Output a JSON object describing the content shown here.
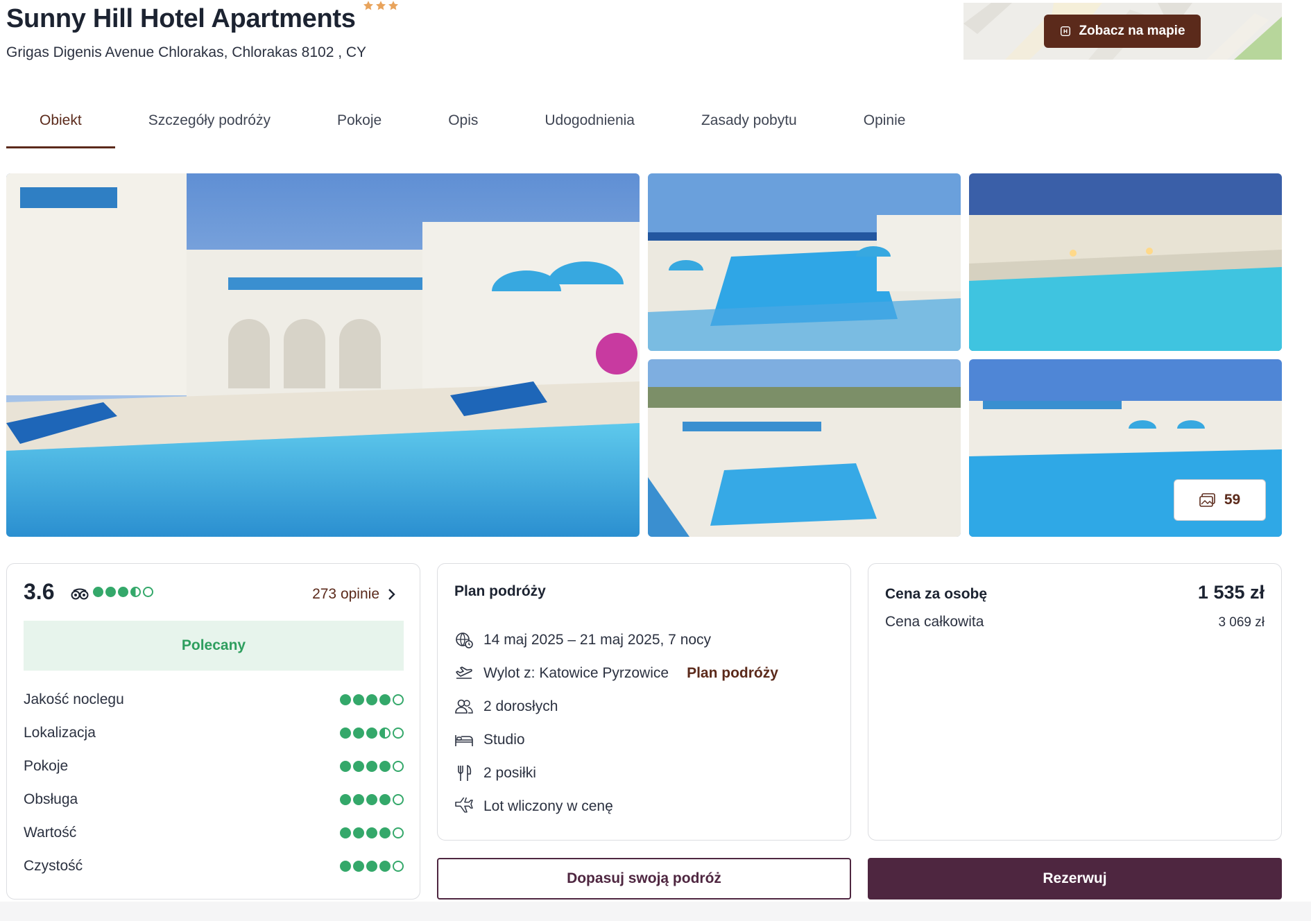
{
  "hotel": {
    "name": "Sunny Hill Hotel Apartments",
    "stars": 3,
    "address": "Grigas Digenis Avenue Chlorakas, Chlorakas 8102 , CY"
  },
  "map": {
    "button_label": "Zobacz na mapie"
  },
  "tabs": [
    {
      "label": "Obiekt",
      "active": true
    },
    {
      "label": "Szczegóły podróży",
      "active": false
    },
    {
      "label": "Pokoje",
      "active": false
    },
    {
      "label": "Opis",
      "active": false
    },
    {
      "label": "Udogodnienia",
      "active": false
    },
    {
      "label": "Zasady pobytu",
      "active": false
    },
    {
      "label": "Opinie",
      "active": false
    }
  ],
  "gallery": {
    "photo_count": "59"
  },
  "rating": {
    "score": "3.6",
    "bubbles": 3.5,
    "reviews_link": "273 opinie",
    "recommended_label": "Polecany",
    "criteria": [
      {
        "label": "Jakość noclegu",
        "bubbles": 4
      },
      {
        "label": "Lokalizacja",
        "bubbles": 3.5
      },
      {
        "label": "Pokoje",
        "bubbles": 4
      },
      {
        "label": "Obsługa",
        "bubbles": 4
      },
      {
        "label": "Wartość",
        "bubbles": 4
      },
      {
        "label": "Czystość",
        "bubbles": 4
      }
    ]
  },
  "plan": {
    "title": "Plan podróży",
    "dates": "14 maj 2025 – 21 maj 2025, 7 nocy",
    "departure": "Wylot z: Katowice Pyrzowice",
    "departure_link": "Plan podróży",
    "guests": "2 dorosłych",
    "room": "Studio",
    "meals": "2 posiłki",
    "flight": "Lot wliczony w cenę"
  },
  "price": {
    "per_person_label": "Cena za osobę",
    "per_person_value": "1 535 zł",
    "total_label": "Cena całkowita",
    "total_value": "3 069 zł"
  },
  "actions": {
    "customize_label": "Dopasuj swoją podróż",
    "book_label": "Rezerwuj"
  },
  "colors": {
    "accent": "#5b2a1b",
    "primary_button": "#4e2640",
    "rating_green": "#34a86a",
    "star_orange": "#e8a35c"
  }
}
